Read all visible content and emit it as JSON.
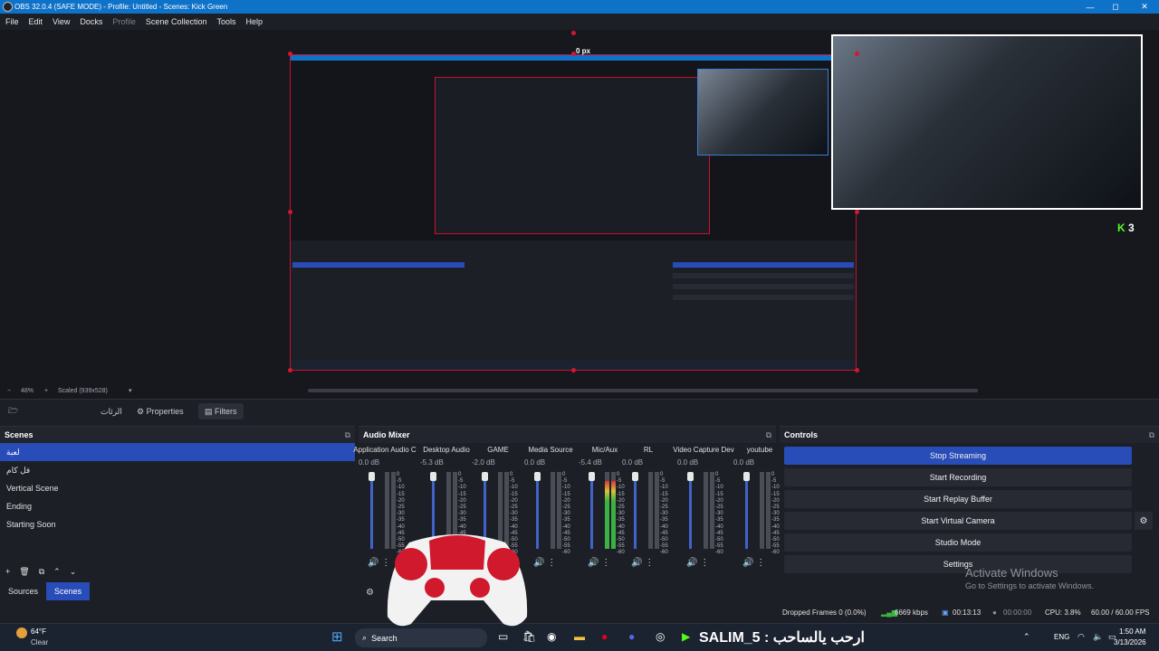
{
  "window": {
    "title": "OBS 32.0.4 (SAFE MODE) - Profile: Untitled - Scenes: Kick Green",
    "minimize": "—",
    "maximize": "◻",
    "close": "✕"
  },
  "menu": [
    "File",
    "Edit",
    "View",
    "Docks",
    "Profile",
    "Scene Collection",
    "Tools",
    "Help"
  ],
  "menu_disabled_index": 4,
  "preview": {
    "px_label": "0 px",
    "kick_count": "3",
    "kick_logo": "K"
  },
  "zoom": {
    "percent": "48%",
    "minus": "−",
    "plus": "+",
    "scaled": "Scaled (939x528)",
    "dropdown": "▾"
  },
  "dock_tabs": {
    "arabic": "الرئات",
    "properties": "Properties",
    "filters": "Filters"
  },
  "scenes": {
    "title": "Scenes",
    "items": [
      "لعبة",
      "فل كام",
      "Vertical Scene",
      "Ending",
      "Starting Soon"
    ],
    "selected_index": 0,
    "tools": [
      "+",
      "🗑",
      "⧉",
      "⌃",
      "⌄"
    ],
    "tabs": [
      "Sources",
      "Scenes"
    ],
    "active_tab": 1
  },
  "audio_mixer": {
    "title": "Audio Mixer",
    "channels": [
      {
        "name": "Application Audio C",
        "db": "0.0 dB",
        "level": 0.0
      },
      {
        "name": "Desktop Audio",
        "db": "-5.3 dB",
        "level": 0.0
      },
      {
        "name": "GAME",
        "db": "-2.0 dB",
        "level": 0.0
      },
      {
        "name": "Media Source",
        "db": "0.0 dB",
        "level": 0.0
      },
      {
        "name": "Mic/Aux",
        "db": "-5.4 dB",
        "level": 0.88
      },
      {
        "name": "RL",
        "db": "0.0 dB",
        "level": 0.0
      },
      {
        "name": "Video Capture Dev",
        "db": "0.0 dB",
        "level": 0.0
      },
      {
        "name": "youtube",
        "db": "0.0 dB",
        "level": 0.0
      }
    ],
    "ticks": [
      "0",
      "-5",
      "-10",
      "-15",
      "-20",
      "-25",
      "-30",
      "-35",
      "-40",
      "-45",
      "-50",
      "-55",
      "-60"
    ]
  },
  "controls": {
    "title": "Controls",
    "buttons": [
      "Stop Streaming",
      "Start Recording",
      "Start Replay Buffer",
      "Start Virtual Camera",
      "Studio Mode",
      "Settings"
    ]
  },
  "status": {
    "dropped": "Dropped Frames 0 (0.0%)",
    "kbps": "6669 kbps",
    "stream_time": "00:13:13",
    "rec_time": "00:00:00",
    "cpu": "CPU: 3.8%",
    "fps": "60.00 / 60.00 FPS"
  },
  "activate": {
    "line1": "Activate Windows",
    "line2": "Go to Settings to activate Windows."
  },
  "taskbar": {
    "temp": "64°F",
    "weather": "Clear",
    "search": "Search",
    "live_text": "SALIM_5 : ارحب يالساحب",
    "lang": "ENG",
    "time": "1:50 AM",
    "date": "3/13/2026"
  },
  "colors": {
    "accent": "#284cb8",
    "title_bar": "#0f72c9",
    "selection_border": "#c8102e",
    "kick_green": "#53fc18",
    "meter_green": "#3bb143"
  }
}
